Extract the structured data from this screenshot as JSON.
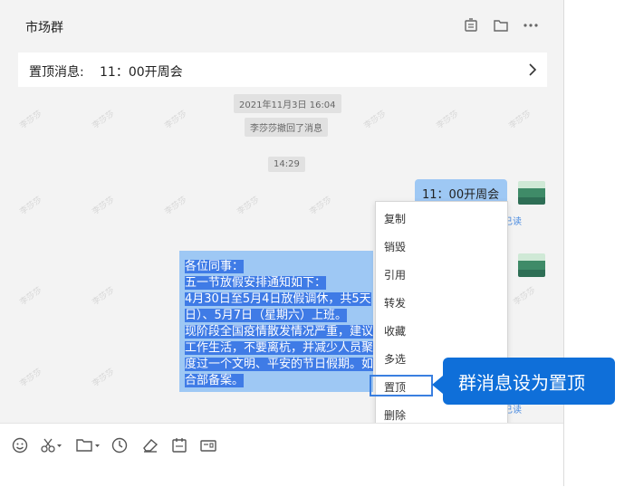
{
  "header": {
    "title": "市场群",
    "icons": [
      "announcement-icon",
      "folder-icon",
      "more-icon"
    ]
  },
  "pinned": {
    "label": "置顶消息:",
    "text": "11：00开周会"
  },
  "watermark": "李莎莎",
  "system": {
    "date": "2021年11月3日 16:04",
    "recall": "李莎莎撤回了消息",
    "time": "14:29"
  },
  "messages": {
    "meeting": "11：00开周会",
    "notice_lines": [
      "各位同事：",
      "五一节放假安排通知如下：",
      "4月30日至5月4日放假调休，共5天",
      "日）、5月7日（星期六）上班。",
      "现阶段全国疫情散发情况严重，建议",
      "工作生活，不要离杭，并减少人员聚",
      "度过一个文明、平安的节日假期。如",
      "合部备案。"
    ]
  },
  "context_menu": {
    "items": [
      "复制",
      "销毁",
      "引用",
      "转发",
      "收藏",
      "多选",
      "置顶",
      "删除"
    ],
    "highlighted": "置顶"
  },
  "callout": {
    "text": "群消息设为置顶"
  },
  "peek": [
    "已读",
    "已读"
  ],
  "toolbar": {
    "icons": [
      "emoji-icon",
      "scissors-icon",
      "folder-icon",
      "clock-icon",
      "eraser-icon",
      "calendar-icon",
      "card-icon"
    ]
  },
  "colors": {
    "accent": "#0f6fd9",
    "bubble": "#9ec8f4",
    "selection": "#3f7be6"
  }
}
